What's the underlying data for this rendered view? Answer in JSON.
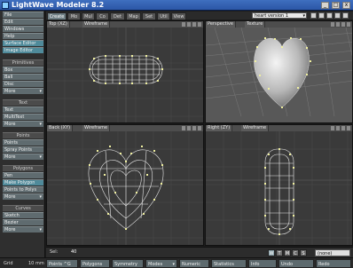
{
  "window": {
    "title": "LightWave Modeler 8.2",
    "min_glyph": "_",
    "max_glyph": "□",
    "close_glyph": "x"
  },
  "sidebar": {
    "top_buttons": [
      "File",
      "Edit",
      "Windows",
      "Help",
      "Surface Editor",
      "Image Editor"
    ],
    "groups": {
      "primitives": {
        "label": "Primitives",
        "items": [
          "Box",
          "Ball",
          "Disc",
          "More"
        ]
      },
      "text": {
        "label": "Text",
        "items": [
          "Text",
          "MultiText",
          "More"
        ]
      },
      "points": {
        "label": "Points",
        "items": [
          "Points",
          "Spray Points",
          "More"
        ]
      },
      "polygons": {
        "label": "Polygons",
        "items": [
          "Pen",
          "Make Polygon",
          "Points to Polys",
          "More"
        ]
      },
      "curves": {
        "label": "Curves",
        "items": [
          "Sketch",
          "Bezier",
          "More"
        ]
      }
    }
  },
  "tabs": [
    "Create",
    "Mo",
    "Mul",
    "Co",
    "Det",
    "Map",
    "Set",
    "Util",
    "View"
  ],
  "layer": {
    "name": "heart version 1"
  },
  "viewports": {
    "top": {
      "view": "Top",
      "axis": "(XZ)",
      "mode": "Wireframe"
    },
    "perspective": {
      "view": "Perspective",
      "mode": "Texture"
    },
    "back": {
      "view": "Back",
      "axis": "(XY)",
      "mode": "Wireframe"
    },
    "right": {
      "view": "Right",
      "axis": "(ZY)",
      "mode": "Wireframe"
    }
  },
  "status": {
    "sel_label": "Sel:",
    "sel_count": "40",
    "modes": [
      "W",
      "T",
      "M",
      "C",
      "S"
    ],
    "dropdown": "(none)"
  },
  "bottom": {
    "grid_label": "Grid",
    "grid_value": "10 mm",
    "points": "Points",
    "points_key": "^G",
    "polygons": "Polygons",
    "symmetry": "Symmetry",
    "modes": "Modes",
    "numeric": "Numeric",
    "statistics": "Statistics",
    "info": "Info",
    "undo": "Undo",
    "redo": "Redo"
  },
  "colors": {
    "accent": "#4f8a9a",
    "wire": "#e8e8e8",
    "point": "#f0f0a0",
    "viewport_bg": "#3a3a3a"
  }
}
